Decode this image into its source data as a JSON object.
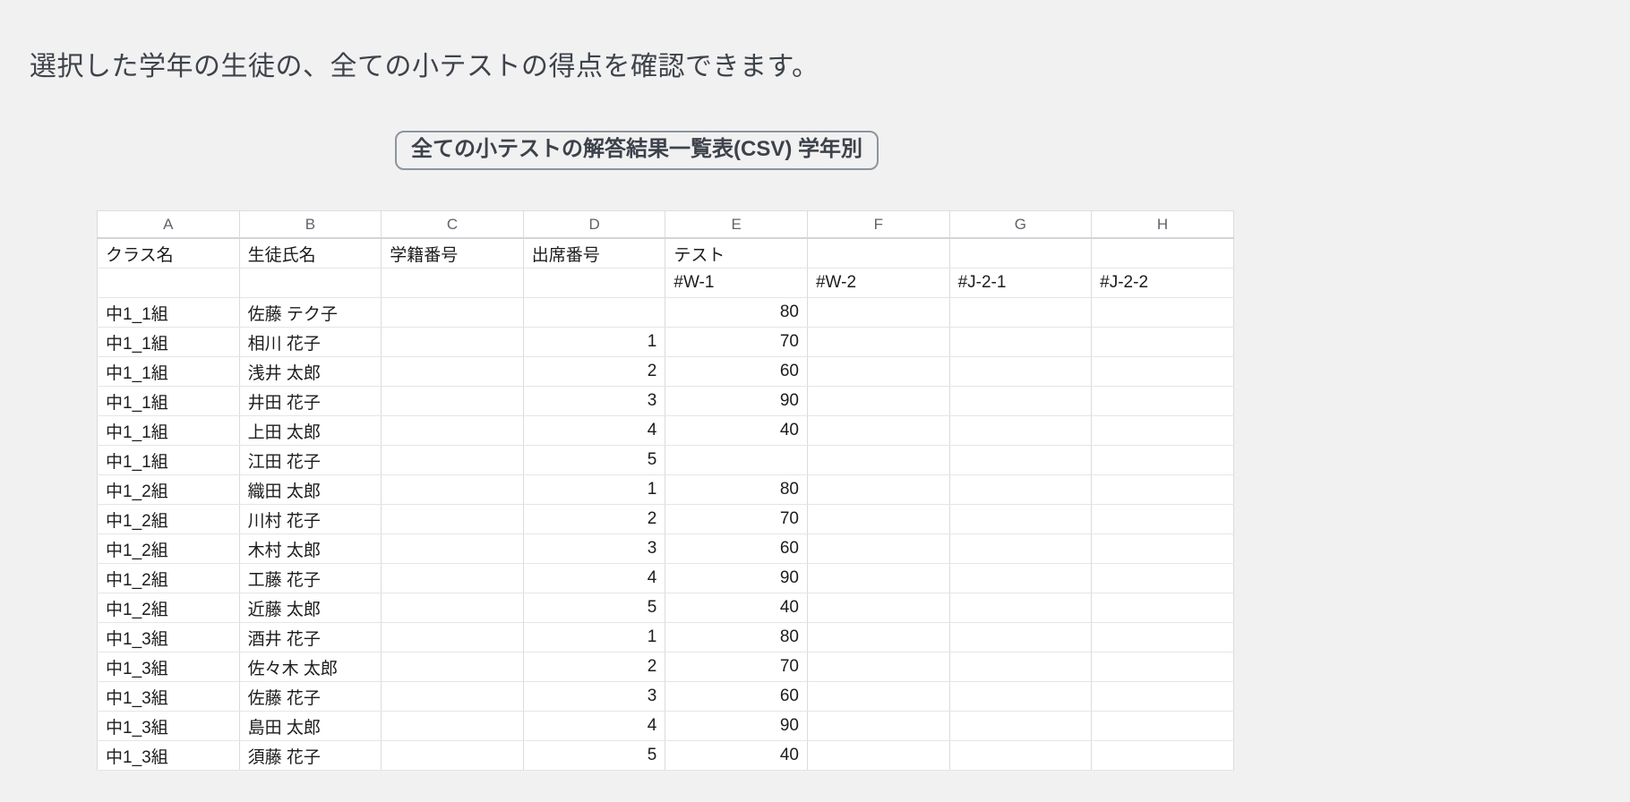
{
  "page": {
    "background_color": "#f1f1f2",
    "description": "選択した学年の生徒の、全ての小テストの得点を確認できます。",
    "download_button_label": "全ての小テストの解答結果一覧表(CSV) 学年別"
  },
  "spreadsheet": {
    "column_letters": [
      "A",
      "B",
      "C",
      "D",
      "E",
      "F",
      "G",
      "H"
    ],
    "header_rows": [
      [
        "クラス名",
        "生徒氏名",
        "学籍番号",
        "出席番号",
        "テスト",
        "",
        "",
        ""
      ],
      [
        "",
        "",
        "",
        "",
        "#W-1",
        "#W-2",
        "#J-2-1",
        "#J-2-2"
      ]
    ],
    "data_rows": [
      [
        "中1_1組",
        "佐藤 テク子",
        "",
        "",
        "80",
        "",
        "",
        ""
      ],
      [
        "中1_1組",
        "相川 花子",
        "",
        "1",
        "70",
        "",
        "",
        ""
      ],
      [
        "中1_1組",
        "浅井 太郎",
        "",
        "2",
        "60",
        "",
        "",
        ""
      ],
      [
        "中1_1組",
        "井田 花子",
        "",
        "3",
        "90",
        "",
        "",
        ""
      ],
      [
        "中1_1組",
        "上田 太郎",
        "",
        "4",
        "40",
        "",
        "",
        ""
      ],
      [
        "中1_1組",
        "江田 花子",
        "",
        "5",
        "",
        "",
        "",
        ""
      ],
      [
        "中1_2組",
        "織田 太郎",
        "",
        "1",
        "80",
        "",
        "",
        ""
      ],
      [
        "中1_2組",
        "川村 花子",
        "",
        "2",
        "70",
        "",
        "",
        ""
      ],
      [
        "中1_2組",
        "木村 太郎",
        "",
        "3",
        "60",
        "",
        "",
        ""
      ],
      [
        "中1_2組",
        "工藤 花子",
        "",
        "4",
        "90",
        "",
        "",
        ""
      ],
      [
        "中1_2組",
        "近藤 太郎",
        "",
        "5",
        "40",
        "",
        "",
        ""
      ],
      [
        "中1_3組",
        "酒井 花子",
        "",
        "1",
        "80",
        "",
        "",
        ""
      ],
      [
        "中1_3組",
        "佐々木 太郎",
        "",
        "2",
        "70",
        "",
        "",
        ""
      ],
      [
        "中1_3組",
        "佐藤 花子",
        "",
        "3",
        "60",
        "",
        "",
        ""
      ],
      [
        "中1_3組",
        "島田 太郎",
        "",
        "4",
        "90",
        "",
        "",
        ""
      ],
      [
        "中1_3組",
        "須藤 花子",
        "",
        "5",
        "40",
        "",
        "",
        ""
      ]
    ]
  }
}
